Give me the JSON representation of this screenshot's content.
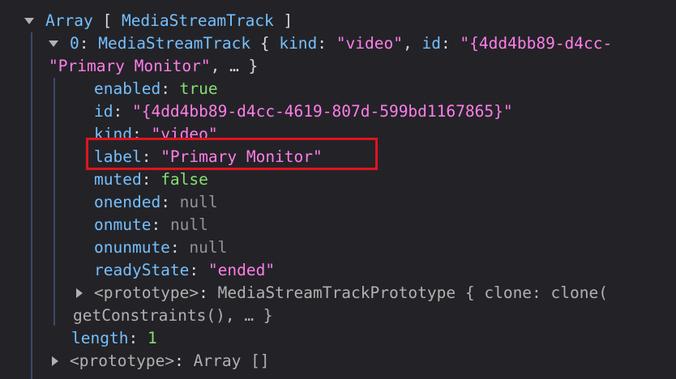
{
  "root": {
    "label": "Array",
    "open_bracket": "[",
    "type": "MediaStreamTrack",
    "close_bracket": "]"
  },
  "item0": {
    "index": "0",
    "type": "MediaStreamTrack",
    "brace_open": "{",
    "preview_kind_key": "kind",
    "preview_kind_val": "\"video\"",
    "preview_id_key": "id",
    "preview_id_val": "\"{4dd4bb89-d4cc-",
    "preview_cont": "\"Primary Monitor\"",
    "preview_ellipsis": ", … }"
  },
  "props": [
    {
      "key": "enabled",
      "value": "true"
    },
    {
      "key": "id",
      "value": "\"{4dd4bb89-d4cc-4619-807d-599bd1167865}\""
    },
    {
      "key": "kind",
      "value": "\"video\""
    },
    {
      "key": "label",
      "value": "\"Primary Monitor\""
    },
    {
      "key": "muted",
      "value": "false"
    },
    {
      "key": "onended",
      "value": "null"
    },
    {
      "key": "onmute",
      "value": "null"
    },
    {
      "key": "onunmute",
      "value": "null"
    },
    {
      "key": "readyState",
      "value": "\"ended\""
    }
  ],
  "item_proto": {
    "key": "<prototype>",
    "value": "MediaStreamTrackPrototype { clone: clone(",
    "cont": "getConstraints(), … }"
  },
  "length": {
    "key": "length",
    "value": "1"
  },
  "root_proto": {
    "key": "<prototype>",
    "value": "Array []"
  },
  "colors": {
    "background": "#232327",
    "key": "#75bfff",
    "string": "#ff7de9",
    "boolean": "#86de74",
    "null": "#939395",
    "highlight": "#e0141e"
  }
}
